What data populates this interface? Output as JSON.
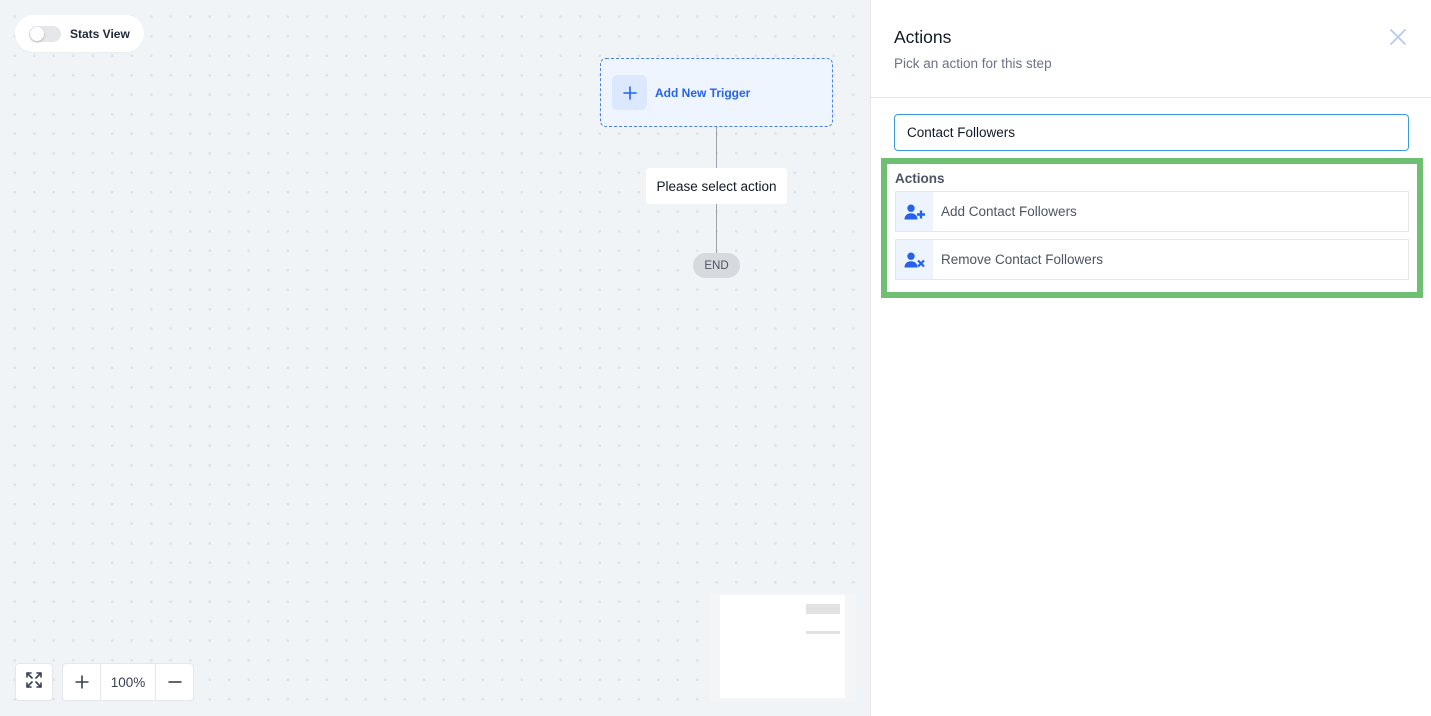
{
  "canvas": {
    "stats_toggle": {
      "label": "Stats View",
      "enabled": false
    },
    "trigger_node": {
      "icon": "plus-icon",
      "label": "Add New Trigger"
    },
    "action_node": {
      "label": "Please select action"
    },
    "end_node": {
      "label": "END"
    },
    "controls": {
      "fit_icon": "expand-icon",
      "zoom_in_icon": "plus-icon",
      "zoom_level": "100%",
      "zoom_out_icon": "minus-icon"
    }
  },
  "panel": {
    "title": "Actions",
    "subtitle": "Pick an action for this step",
    "close_icon": "close-icon",
    "search": {
      "value": "Contact Followers",
      "placeholder": ""
    },
    "results": {
      "heading": "Actions",
      "items": [
        {
          "icon": "user-plus-icon",
          "label": "Add Contact Followers"
        },
        {
          "icon": "user-remove-icon",
          "label": "Remove Contact Followers"
        }
      ]
    },
    "colors": {
      "accent": "#2563eb",
      "highlight_border": "#6fbf73",
      "input_focus": "#3b9ad9"
    }
  }
}
